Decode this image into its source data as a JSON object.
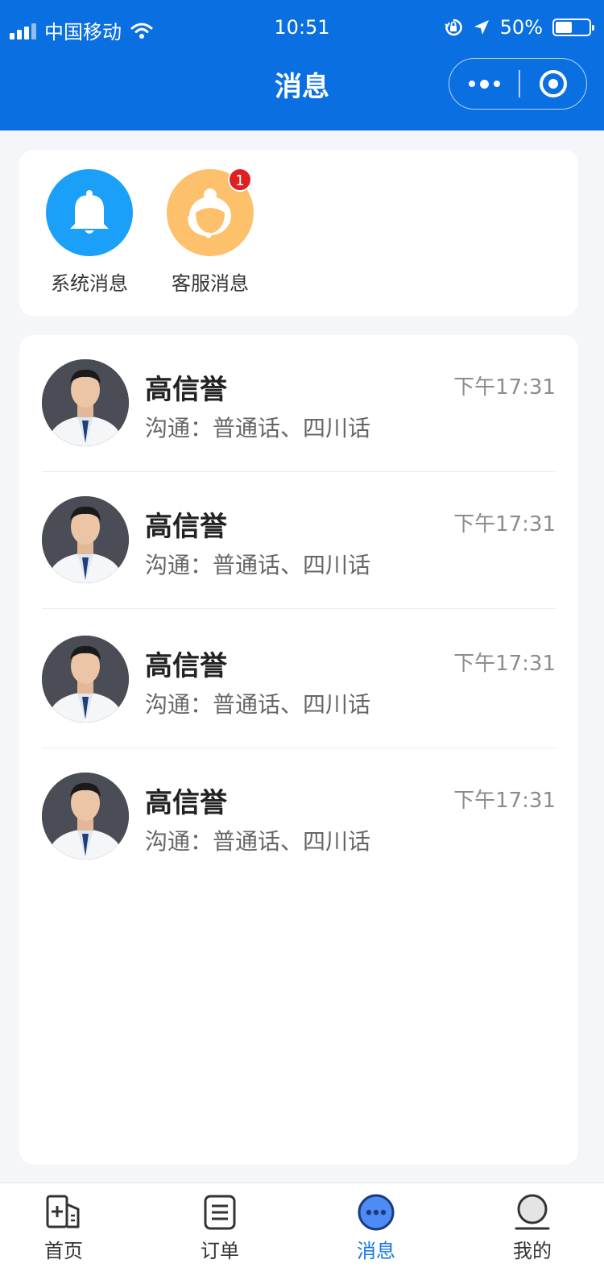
{
  "status_bar": {
    "carrier": "中国移动",
    "time": "10:51",
    "battery": "50%"
  },
  "nav": {
    "title": "消息"
  },
  "quick_entries": [
    {
      "label": "系统消息",
      "icon": "bell-icon",
      "color": "#1aa0f8"
    },
    {
      "label": "客服消息",
      "icon": "customer-service-icon",
      "color": "#fdc06b",
      "badge": "1"
    }
  ],
  "messages": [
    {
      "name": "高信誉",
      "time": "下午17:31",
      "desc": "沟通：普通话、四川话"
    },
    {
      "name": "高信誉",
      "time": "下午17:31",
      "desc": "沟通：普通话、四川话"
    },
    {
      "name": "高信誉",
      "time": "下午17:31",
      "desc": "沟通：普通话、四川话"
    },
    {
      "name": "高信誉",
      "time": "下午17:31",
      "desc": "沟通：普通话、四川话"
    }
  ],
  "tabbar": {
    "tabs": [
      {
        "label": "首页",
        "icon": "home-icon"
      },
      {
        "label": "订单",
        "icon": "order-list-icon"
      },
      {
        "label": "消息",
        "icon": "message-icon",
        "active": true
      },
      {
        "label": "我的",
        "icon": "profile-icon"
      }
    ]
  },
  "colors": {
    "brand": "#0a6fe0",
    "active_tab": "#1677e8",
    "badge": "#e02020"
  }
}
